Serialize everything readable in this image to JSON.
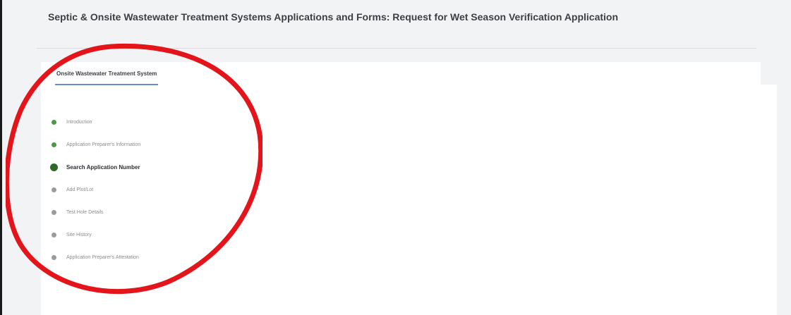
{
  "page": {
    "title": "Septic & Onsite Wastewater Treatment Systems Applications and Forms: Request for Wet Season Verification Application"
  },
  "tabs": [
    {
      "label": "Onsite Wastewater Treatment System"
    }
  ],
  "steps": [
    {
      "label": "Introduction",
      "status": "complete"
    },
    {
      "label": "Application Preparer's Information",
      "status": "complete"
    },
    {
      "label": "Search Application Number",
      "status": "current"
    },
    {
      "label": "Add Plot/Lot",
      "status": "pending"
    },
    {
      "label": "Test Hole Details",
      "status": "pending"
    },
    {
      "label": "Site History",
      "status": "pending"
    },
    {
      "label": "Application Preparer's Attestation",
      "status": "pending"
    }
  ],
  "colors": {
    "complete": "#4b9a43",
    "current": "#2e6a28",
    "pending": "#9a9b9d",
    "tab_underline": "#6a8fbf",
    "annotation_circle": "#e3151b"
  }
}
